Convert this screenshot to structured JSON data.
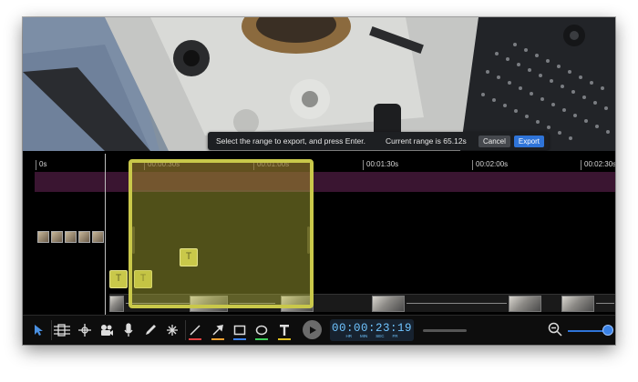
{
  "export_bar": {
    "message": "Select the range to export, and press Enter.",
    "range_text": "Current range is 65.12s",
    "cancel_label": "Cancel",
    "export_label": "Export"
  },
  "ruler": {
    "ticks": [
      "0s",
      "00:00:30s",
      "00:01:00s",
      "00:01:30s",
      "00:02:00s",
      "00:02:30s"
    ]
  },
  "timeline": {
    "text_clip_glyph": "T"
  },
  "toolbar": {
    "tools": [
      "select-arrow-icon",
      "timeline-layout-icon",
      "move-arrows-icon",
      "camera-icon",
      "microphone-icon",
      "pen-icon",
      "sparkle-icon",
      "line-icon",
      "arrow-icon",
      "rectangle-icon",
      "ellipse-icon",
      "text-icon"
    ],
    "underline_colors": {
      "line": "#e34242",
      "arrow": "#f0a030",
      "rectangle": "#3b82f6",
      "ellipse": "#3ecf5a",
      "text": "#e0c020"
    },
    "timecode": "00:00:23:19",
    "timecode_labels": [
      "HR",
      "MIN",
      "SEC",
      "FR"
    ]
  },
  "colors": {
    "selection": "#c9c84a",
    "export_button": "#2f74d8",
    "timecode_text": "#6fc4ff",
    "purple_track": "#3a1531"
  }
}
